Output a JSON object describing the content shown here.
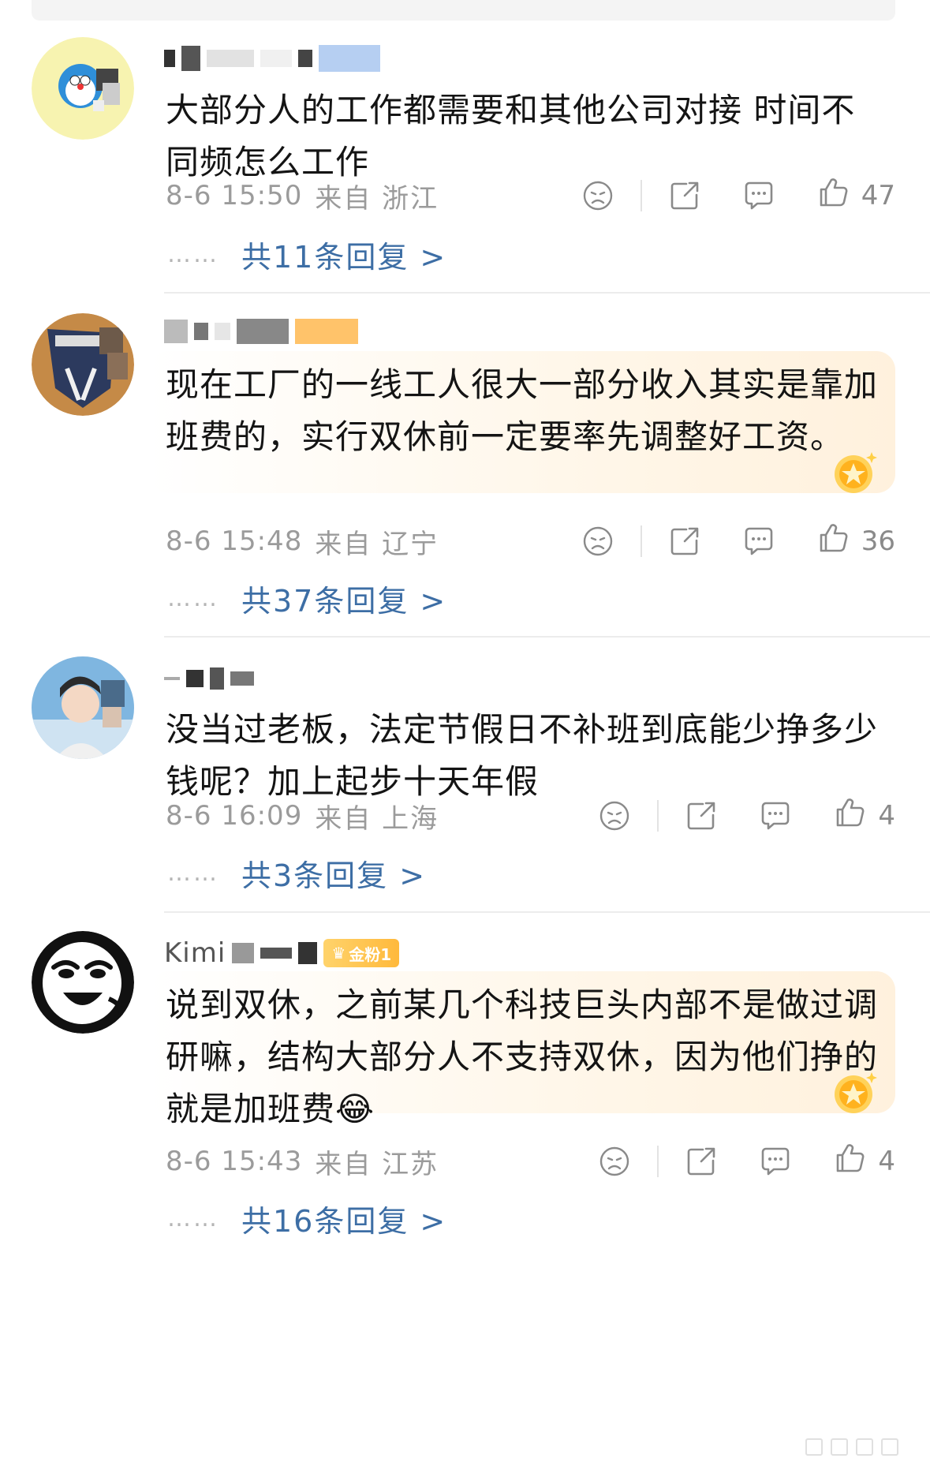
{
  "comments": [
    {
      "text": "大部分人的工作都需要和其他公司对接 时间不同频怎么工作",
      "time": "8-6 15:50",
      "location": "来自 浙江",
      "likes": "47",
      "replies_label": "共11条回复 >",
      "highlighted": false
    },
    {
      "text": "现在工厂的一线工人很大一部分收入其实是靠加班费的，实行双休前一定要率先调整好工资。",
      "time": "8-6 15:48",
      "location": "来自 辽宁",
      "likes": "36",
      "replies_label": "共37条回复 >",
      "highlighted": true
    },
    {
      "text": "没当过老板，法定节假日不补班到底能少挣多少钱呢？加上起步十天年假",
      "time": "8-6 16:09",
      "location": "来自 上海",
      "likes": "4",
      "replies_label": "共3条回复 >",
      "highlighted": false
    },
    {
      "username_partial": "Kimi",
      "badge": "金粉1",
      "text": "说到双休，之前某几个科技巨头内部不是做过调研嘛，结构大部分人不支持双休，因为他们挣的就是加班费😂",
      "time": "8-6 15:43",
      "location": "来自 江苏",
      "likes": "4",
      "replies_label": "共16条回复 >",
      "highlighted": true
    }
  ],
  "icons": {
    "sad": "sad-face-icon",
    "share": "share-icon",
    "comment": "comment-icon",
    "like": "thumbs-up-icon",
    "highlight": "gold-star-badge-icon"
  },
  "colors": {
    "reply_link": "#3d6ea5",
    "meta_text": "#9b9b9b",
    "highlight_bg": "#fff3e2"
  },
  "reply_dots": "……"
}
